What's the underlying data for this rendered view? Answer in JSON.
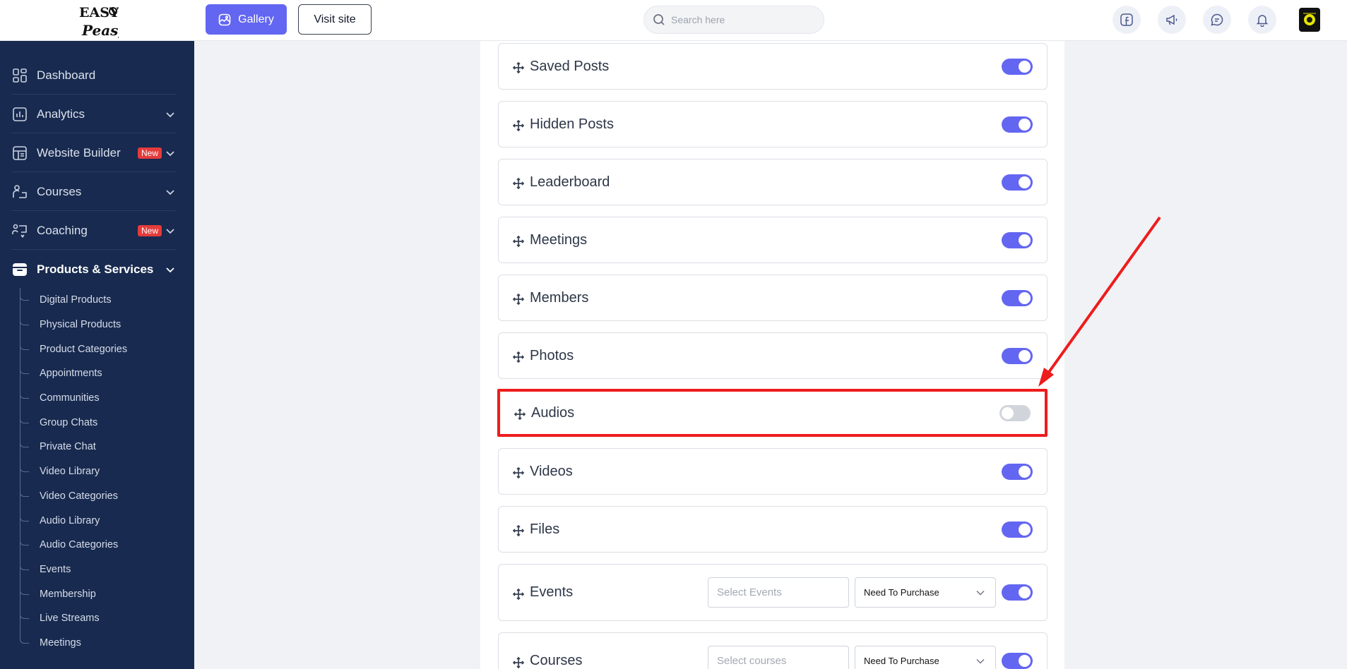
{
  "brand": {
    "logo_text_top": "EASY",
    "logo_text_bottom": "Peasy"
  },
  "topbar": {
    "gallery_label": "Gallery",
    "visit_label": "Visit site",
    "search_placeholder": "Search here"
  },
  "sidebar": {
    "items": [
      {
        "label": "Dashboard",
        "icon": "grid-icon"
      },
      {
        "label": "Analytics",
        "icon": "bar-chart-icon"
      },
      {
        "label": "Website Builder",
        "icon": "layout-icon",
        "badge": "New"
      },
      {
        "label": "Courses",
        "icon": "person-at-desk-icon"
      },
      {
        "label": "Coaching",
        "icon": "coaching-icon",
        "badge": "New"
      },
      {
        "label": "Products & Services",
        "icon": "box-icon"
      }
    ],
    "sub_items": [
      "Digital Products",
      "Physical Products",
      "Product Categories",
      "Appointments",
      "Communities",
      "Group Chats",
      "Private Chat",
      "Video Library",
      "Video Categories",
      "Audio Library",
      "Audio Categories",
      "Events",
      "Membership",
      "Live Streams",
      "Meetings"
    ]
  },
  "rows": [
    {
      "title": "Saved Posts",
      "enabled": true
    },
    {
      "title": "Hidden Posts",
      "enabled": true
    },
    {
      "title": "Leaderboard",
      "enabled": true
    },
    {
      "title": "Meetings",
      "enabled": true
    },
    {
      "title": "Members",
      "enabled": true
    },
    {
      "title": "Photos",
      "enabled": true
    },
    {
      "title": "Audios",
      "enabled": false
    },
    {
      "title": "Videos",
      "enabled": true
    },
    {
      "title": "Files",
      "enabled": true
    },
    {
      "title": "Events",
      "enabled": true,
      "select_placeholder": "Select Events",
      "dropdown_value": "Need To Purchase"
    },
    {
      "title": "Courses",
      "enabled": true,
      "select_placeholder": "Select courses",
      "dropdown_value": "Need To Purchase"
    }
  ],
  "colors": {
    "accent": "#6366f1",
    "sidebar": "#182a4f",
    "highlight": "#ee1c1c",
    "badge": "#e53b3b"
  }
}
